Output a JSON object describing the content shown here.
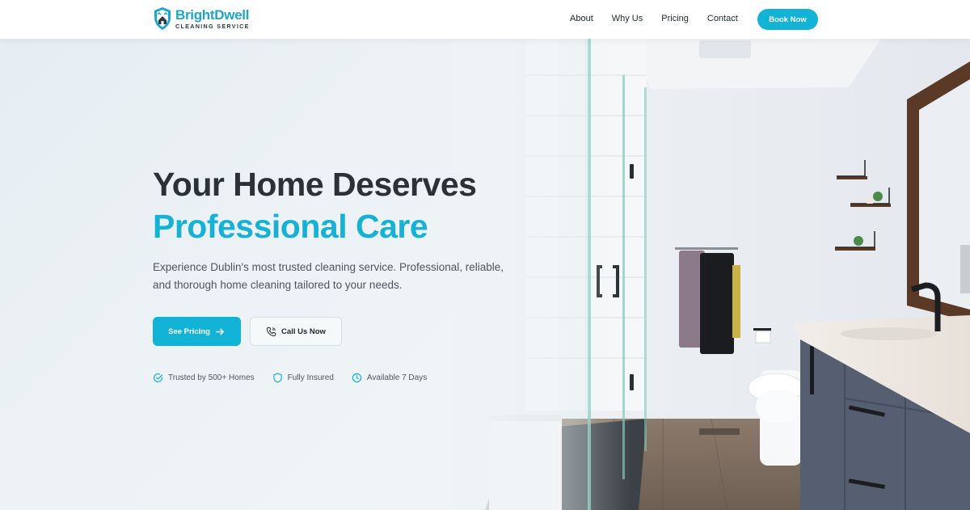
{
  "brand": {
    "name": "BrightDwell",
    "tagline": "CLEANING SERVICE",
    "colors": {
      "accent": "#12b3d6",
      "dark": "#2b3237"
    }
  },
  "nav": {
    "items": [
      {
        "label": "About"
      },
      {
        "label": "Why Us"
      },
      {
        "label": "Pricing"
      },
      {
        "label": "Contact"
      }
    ],
    "cta_label": "Book Now"
  },
  "hero": {
    "headline_line1": "Your Home Deserves",
    "headline_line2": "Professional Care",
    "subtext": "Experience Dublin's most trusted cleaning service. Professional, reliable, and thorough home cleaning tailored to your needs.",
    "primary_button": {
      "label": "See Pricing",
      "icon": "arrow-right-icon"
    },
    "secondary_button": {
      "label": "Call Us Now",
      "icon": "phone-icon"
    },
    "trust_badges": [
      {
        "label": "Trusted by 500+ Homes",
        "icon": "check-circle-icon"
      },
      {
        "label": "Fully Insured",
        "icon": "shield-icon"
      },
      {
        "label": "Available 7 Days",
        "icon": "clock-icon"
      }
    ]
  }
}
